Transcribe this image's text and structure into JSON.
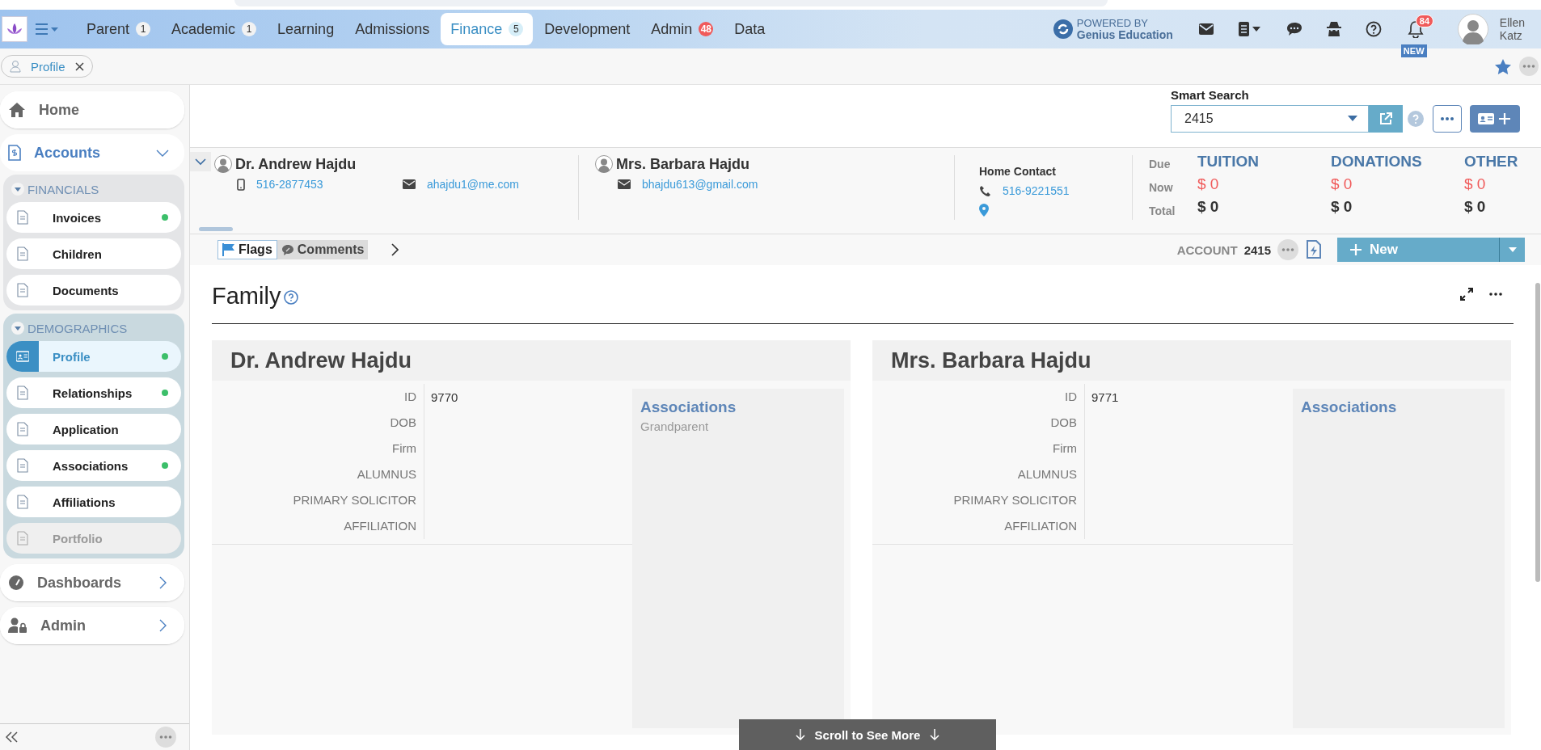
{
  "nav": {
    "tabs": [
      {
        "label": "Parent",
        "count": "1",
        "alert": false,
        "selected": false
      },
      {
        "label": "Academic",
        "count": "1",
        "alert": false,
        "selected": false
      },
      {
        "label": "Learning",
        "selected": false
      },
      {
        "label": "Admissions",
        "selected": false
      },
      {
        "label": "Finance",
        "count": "5",
        "alert": false,
        "selected": true
      },
      {
        "label": "Development",
        "selected": false
      },
      {
        "label": "Admin",
        "count": "48",
        "alert": true,
        "selected": false
      },
      {
        "label": "Data",
        "selected": false
      }
    ],
    "powered_by": "POWERED BY",
    "brand": "Genius Education",
    "notifications": "84",
    "new_badge": "NEW",
    "user_first": "Ellen",
    "user_last": "Katz"
  },
  "open_tabs": [
    {
      "label": "Profile"
    }
  ],
  "sidebar": {
    "sections": [
      {
        "label": "Home"
      },
      {
        "label": "Accounts",
        "expanded": true,
        "groups": [
          {
            "label": "FINANCIALS",
            "items": [
              {
                "label": "Invoices",
                "dot": true,
                "selected": false,
                "disabled": false
              },
              {
                "label": "Children",
                "dot": false,
                "selected": false,
                "disabled": false
              },
              {
                "label": "Documents",
                "dot": false,
                "selected": false,
                "disabled": false
              }
            ]
          },
          {
            "label": "DEMOGRAPHICS",
            "items": [
              {
                "label": "Profile",
                "dot": true,
                "selected": true,
                "disabled": false
              },
              {
                "label": "Relationships",
                "dot": true,
                "selected": false,
                "disabled": false
              },
              {
                "label": "Application",
                "dot": false,
                "selected": false,
                "disabled": false
              },
              {
                "label": "Associations",
                "dot": true,
                "selected": false,
                "disabled": false
              },
              {
                "label": "Affiliations",
                "dot": false,
                "selected": false,
                "disabled": false
              },
              {
                "label": "Portfolio",
                "dot": false,
                "selected": false,
                "disabled": true
              }
            ]
          }
        ]
      },
      {
        "label": "Dashboards",
        "expanded": false
      },
      {
        "label": "Admin",
        "expanded": false
      }
    ]
  },
  "smart_search": {
    "label": "Smart Search",
    "value": "2415"
  },
  "header": {
    "contacts": [
      {
        "name": "Dr. Andrew Hajdu",
        "phone": "516-2877453",
        "email": "ahajdu1@me.com"
      },
      {
        "name": "Mrs. Barbara Hajdu",
        "email": "bhajdu613@gmail.com"
      }
    ],
    "home_contact": {
      "label": "Home Contact",
      "phone": "516-9221551"
    },
    "balance_rows": [
      "Due",
      "Now",
      "Total"
    ],
    "balances": [
      {
        "title": "TUITION",
        "now": "$ 0",
        "total": "$ 0"
      },
      {
        "title": "DONATIONS",
        "now": "$ 0",
        "total": "$ 0"
      },
      {
        "title": "OTHER",
        "now": "$ 0",
        "total": "$ 0"
      }
    ]
  },
  "toolbar": {
    "tabs": [
      {
        "label": "Flags",
        "selected": true
      },
      {
        "label": "Comments",
        "selected": false
      }
    ],
    "account_label": "ACCOUNT",
    "account_number": "2415",
    "new_button": "New"
  },
  "family": {
    "title": "Family",
    "members": [
      {
        "name": "Dr. Andrew Hajdu",
        "fields": [
          {
            "label": "ID",
            "value": "9770"
          },
          {
            "label": "DOB"
          },
          {
            "label": "Firm"
          },
          {
            "label": "ALUMNUS"
          },
          {
            "label": "PRIMARY SOLICITOR"
          },
          {
            "label": "AFFILIATION"
          }
        ],
        "associations_title": "Associations",
        "associations": [
          "Grandparent"
        ]
      },
      {
        "name": "Mrs. Barbara Hajdu",
        "fields": [
          {
            "label": "ID",
            "value": "9771"
          },
          {
            "label": "DOB"
          },
          {
            "label": "Firm"
          },
          {
            "label": "ALUMNUS"
          },
          {
            "label": "PRIMARY SOLICITOR"
          },
          {
            "label": "AFFILIATION"
          }
        ],
        "associations_title": "Associations"
      }
    ]
  },
  "scroll_hint": "Scroll to See More"
}
